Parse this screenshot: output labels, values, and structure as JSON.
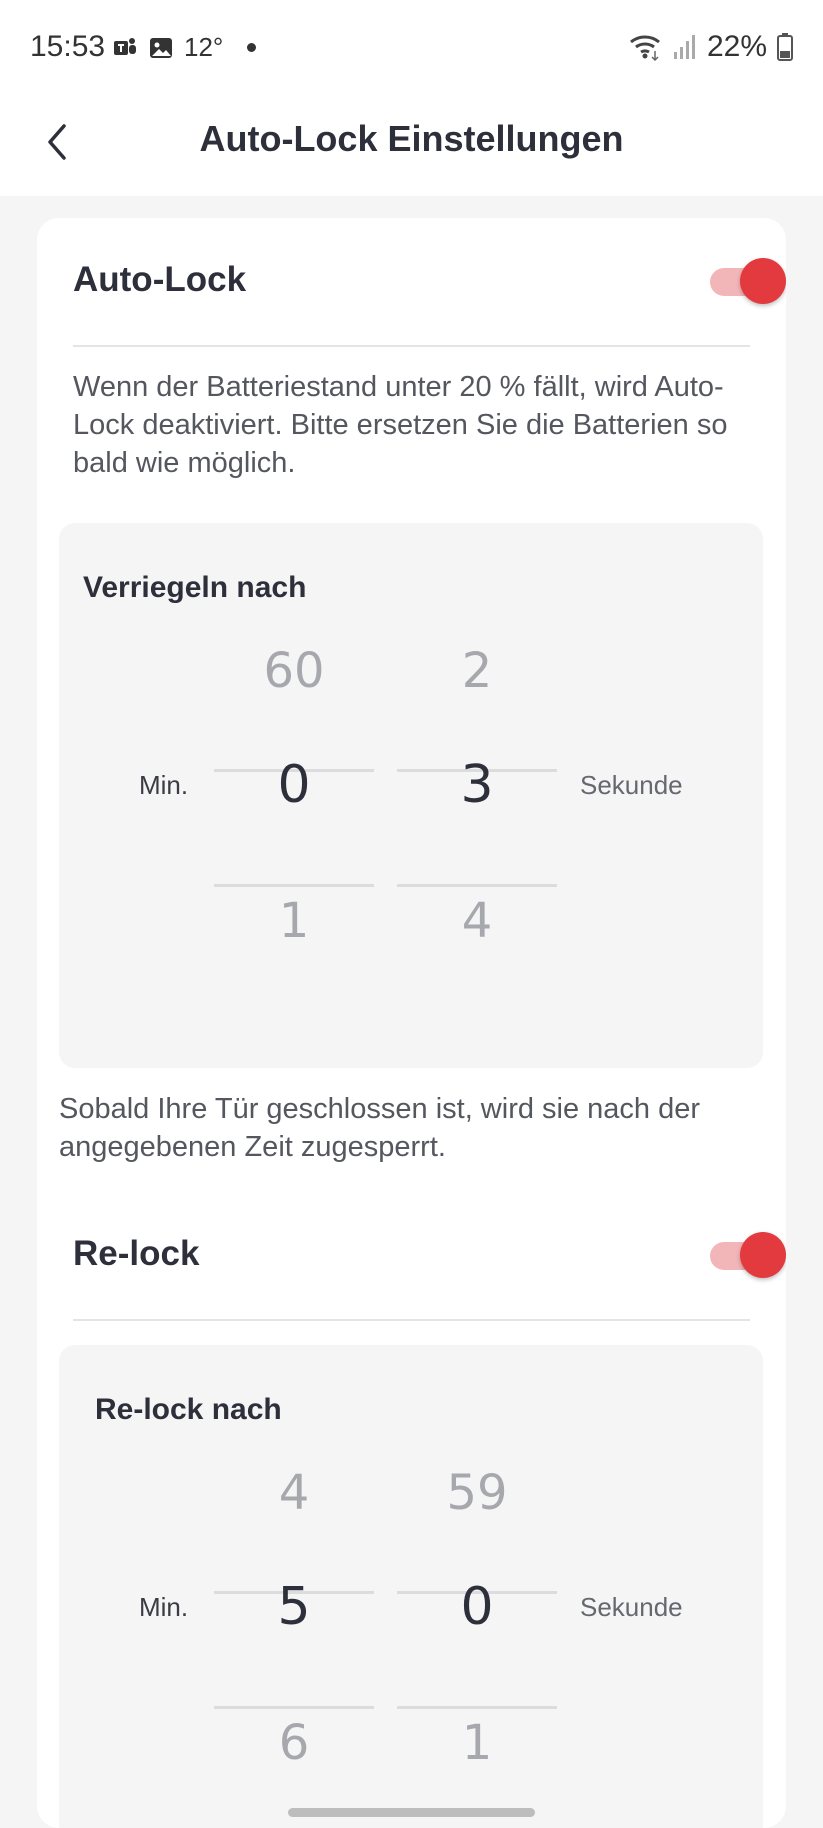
{
  "status_bar": {
    "time": "15:53",
    "temperature": "12°",
    "battery": "22%",
    "icons": [
      "teams-icon",
      "gallery-icon",
      "wifi-icon",
      "signal-icon",
      "battery-icon"
    ]
  },
  "header": {
    "title": "Auto-Lock Einstellungen"
  },
  "auto_lock": {
    "title": "Auto-Lock",
    "enabled": true,
    "description": "Wenn der Batteriestand unter 20 % fällt, wird Auto-Lock deaktiviert. Bitte ersetzen Sie die Batterien so bald wie möglich.",
    "picker": {
      "title": "Verriegeln nach",
      "min_label": "Min.",
      "sec_label": "Sekunde",
      "minutes": {
        "prev": "60",
        "selected": "0",
        "next": "1"
      },
      "seconds": {
        "prev": "2",
        "selected": "3",
        "next": "4"
      }
    },
    "footer": "Sobald Ihre Tür geschlossen ist, wird sie nach der angegebenen Zeit zugesperrt."
  },
  "re_lock": {
    "title": "Re-lock",
    "enabled": true,
    "picker": {
      "title": "Re-lock nach",
      "min_label": "Min.",
      "sec_label": "Sekunde",
      "minutes": {
        "prev": "4",
        "selected": "5",
        "next": "6"
      },
      "seconds": {
        "prev": "59",
        "selected": "0",
        "next": "1"
      }
    }
  },
  "colors": {
    "accent": "#e23a3f",
    "accent_light": "#f3b6b8"
  }
}
